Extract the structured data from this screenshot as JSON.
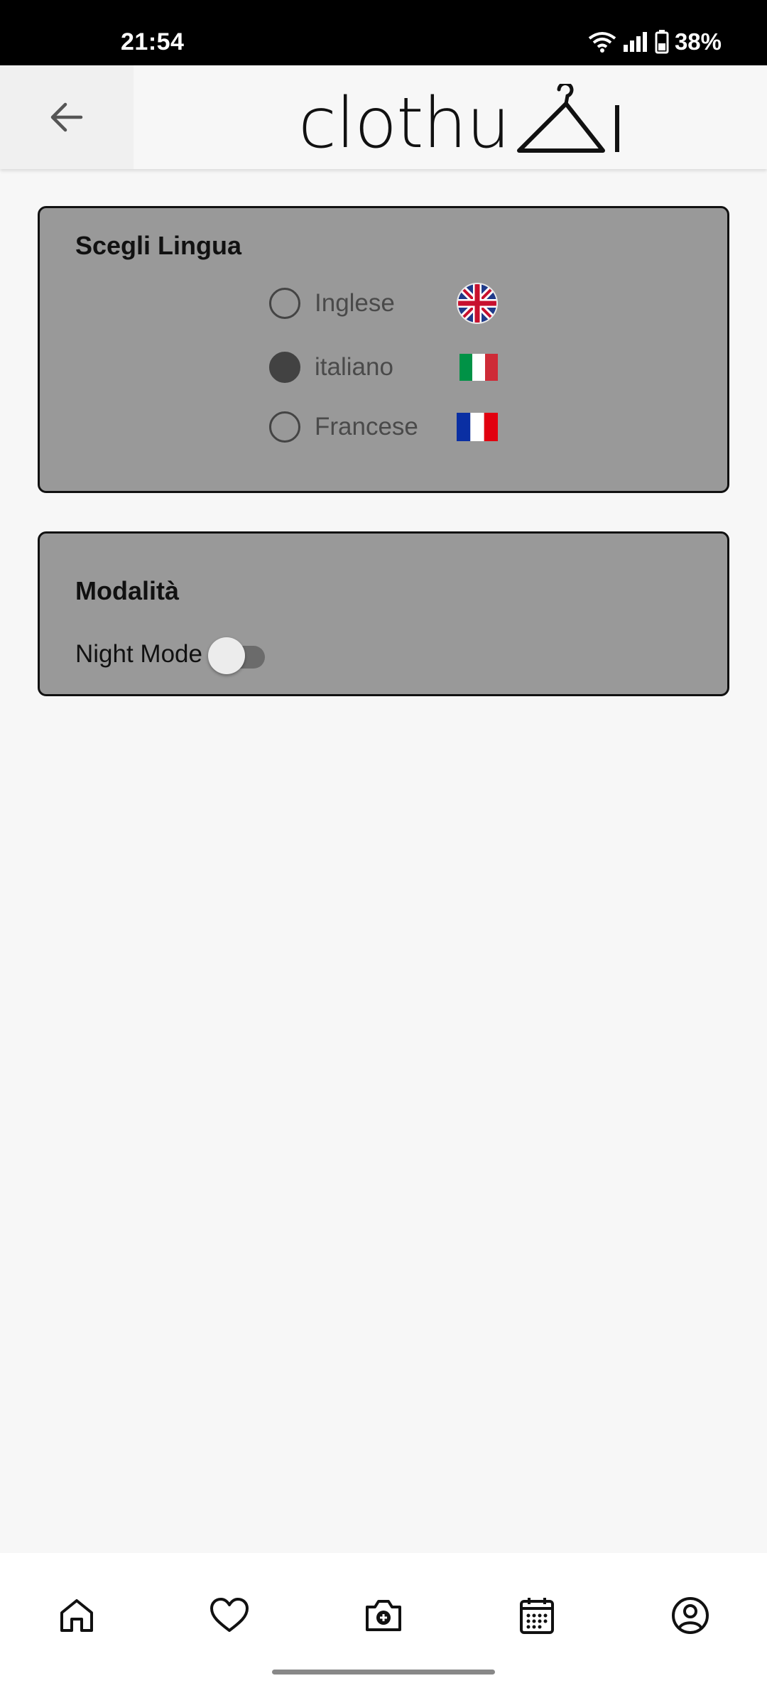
{
  "status_bar": {
    "time": "21:54",
    "battery": "38%",
    "icons": [
      "wifi-icon",
      "signal-icon",
      "battery-icon"
    ]
  },
  "app_bar": {
    "back_icon": "arrow-left-icon",
    "brand": "clothu",
    "brand_mark": "hanger-logo-icon"
  },
  "language_card": {
    "title": "Scegli Lingua",
    "options": [
      {
        "label": "Inglese",
        "selected": false,
        "flag": "uk-flag-icon"
      },
      {
        "label": "italiano",
        "selected": true,
        "flag": "italy-flag-icon"
      },
      {
        "label": "Francese",
        "selected": false,
        "flag": "france-flag-icon"
      }
    ]
  },
  "mode_card": {
    "title": "Modalità",
    "night_mode_label": "Night Mode",
    "night_mode_on": false
  },
  "bottom_nav": {
    "items": [
      "home-icon",
      "heart-icon",
      "camera-add-icon",
      "calendar-icon",
      "profile-icon"
    ]
  },
  "colors": {
    "card_bg": "#999999",
    "page_bg": "#f7f7f7",
    "status_bg": "#000000"
  }
}
